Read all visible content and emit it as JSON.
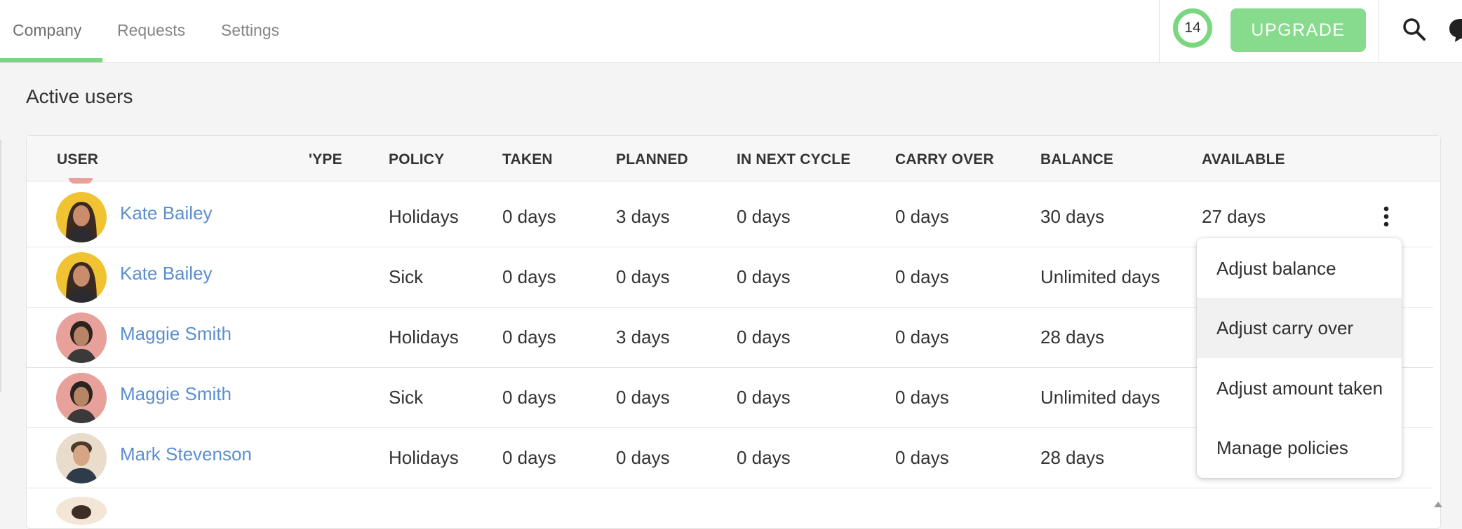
{
  "nav": {
    "tabs": [
      {
        "label": "Company",
        "active": true
      },
      {
        "label": "Requests",
        "active": false
      },
      {
        "label": "Settings",
        "active": false
      }
    ],
    "credits": "14",
    "upgrade_label": "UPGRADE",
    "accent_color": "#7ad77f"
  },
  "page": {
    "title": "Active users"
  },
  "table": {
    "columns": [
      "USER",
      "'YPE",
      "POLICY",
      "TAKEN",
      "PLANNED",
      "IN NEXT CYCLE",
      "CARRY OVER",
      "BALANCE",
      "AVAILABLE"
    ],
    "rows": [
      {
        "user": "Kate Bailey",
        "avatar": "avatar-kate",
        "policy": "Holidays",
        "taken": "0 days",
        "planned": "3 days",
        "next_cycle": "0 days",
        "carry_over": "0 days",
        "balance": "30 days",
        "available": "27 days"
      },
      {
        "user": "Kate Bailey",
        "avatar": "avatar-kate",
        "policy": "Sick",
        "taken": "0 days",
        "planned": "0 days",
        "next_cycle": "0 days",
        "carry_over": "0 days",
        "balance": "Unlimited days",
        "available": ""
      },
      {
        "user": "Maggie Smith",
        "avatar": "avatar-maggie",
        "policy": "Holidays",
        "taken": "0 days",
        "planned": "3 days",
        "next_cycle": "0 days",
        "carry_over": "0 days",
        "balance": "28 days",
        "available": ""
      },
      {
        "user": "Maggie Smith",
        "avatar": "avatar-maggie",
        "policy": "Sick",
        "taken": "0 days",
        "planned": "0 days",
        "next_cycle": "0 days",
        "carry_over": "0 days",
        "balance": "Unlimited days",
        "available": ""
      },
      {
        "user": "Mark Stevenson",
        "avatar": "avatar-mark",
        "policy": "Holidays",
        "taken": "0 days",
        "planned": "0 days",
        "next_cycle": "0 days",
        "carry_over": "0 days",
        "balance": "28 days",
        "available": ""
      }
    ]
  },
  "row_menu": {
    "items": [
      "Adjust balance",
      "Adjust carry over",
      "Adjust amount taken",
      "Manage policies"
    ],
    "hovered_index": 1
  },
  "icons": [
    "search-icon",
    "chat-icon",
    "more-vertical-icon"
  ]
}
